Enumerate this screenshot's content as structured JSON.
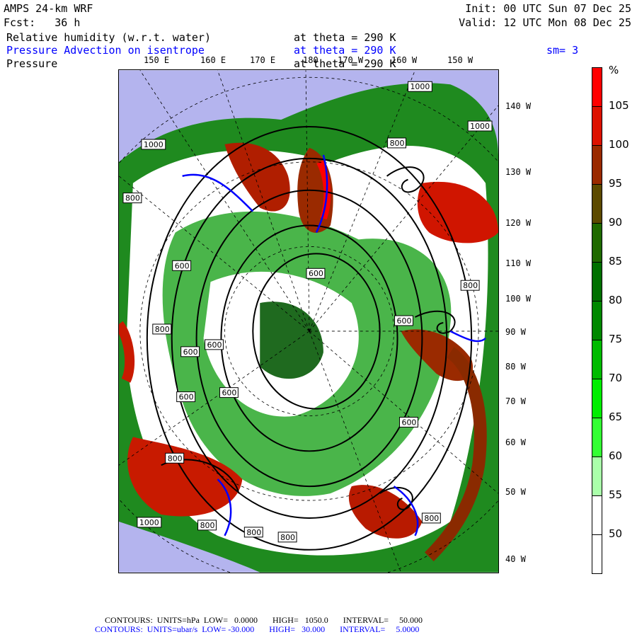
{
  "header": {
    "model": "AMPS 24-km WRF",
    "forecast": "Fcst:   36 h",
    "init": "Init: 00 UTC Sun 07 Dec 25",
    "valid": "Valid: 12 UTC Mon 08 Dec 25",
    "field1": "Relative humidity (w.r.t. water)",
    "field1_level": "at theta = 290 K",
    "field2": "Pressure Advection on isentrope",
    "field2_level": "at theta = 290 K",
    "smoothing": "sm= 3",
    "field3": "Pressure",
    "field3_level": "at theta = 290 K"
  },
  "top_lon_labels": [
    "150 E",
    "160 E",
    "170 E",
    "180",
    "170 W",
    "160 W",
    "150 W"
  ],
  "right_lon_labels": [
    "140 W",
    "130 W",
    "120 W",
    "110 W",
    "100 W",
    "90 W",
    "80 W",
    "70 W",
    "60 W",
    "50 W",
    "40 W"
  ],
  "contour_labels": [
    "1000",
    "800",
    "1000",
    "1000",
    "800",
    "600",
    "600",
    "800",
    "800",
    "600",
    "600",
    "600",
    "600",
    "600",
    "600",
    "800",
    "1000",
    "800",
    "800",
    "800",
    "800"
  ],
  "colorbar": {
    "unit": "%",
    "labels": [
      "105",
      "100",
      "95",
      "90",
      "85",
      "80",
      "75",
      "70",
      "65",
      "60",
      "55",
      "50"
    ],
    "colors": [
      "#ff0000",
      "#dd1100",
      "#9a2a00",
      "#5c4a00",
      "#1f6a00",
      "#007000",
      "#008800",
      "#00bb00",
      "#00ee00",
      "#33ff33",
      "#aaffaa",
      "#ffffff",
      "#ffffff"
    ]
  },
  "footer": {
    "line1": "CONTOURS:  UNITS=hPa  LOW=   0.0000       HIGH=   1050.0       INTERVAL=     50.000",
    "line2": "CONTOURS:  UNITS=ubar/s  LOW= -30.000       HIGH=   30.000       INTERVAL=     5.0000"
  }
}
